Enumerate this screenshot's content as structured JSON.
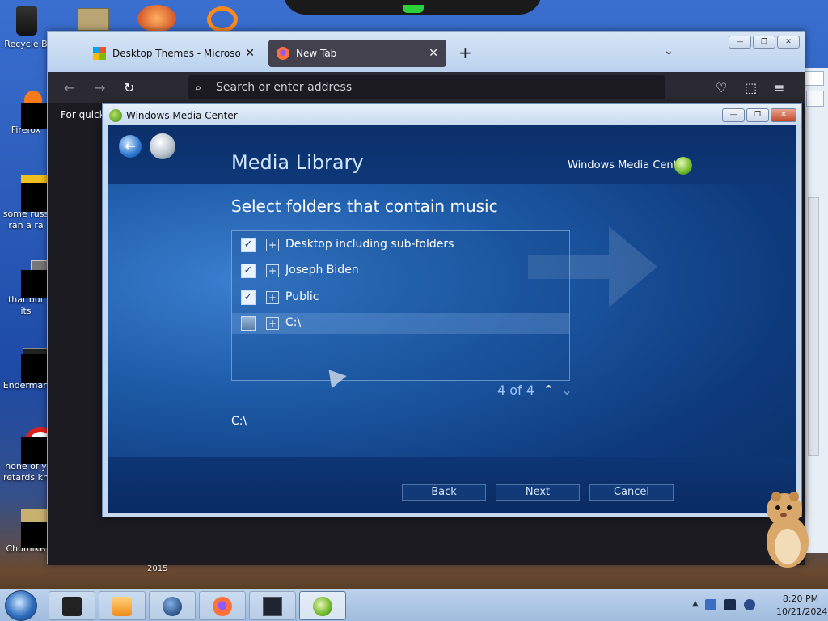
{
  "desktop": {
    "icons": [
      {
        "label": "Recycle B"
      },
      {
        "label": "Firefox"
      },
      {
        "label_line1": "some russ",
        "label_line2": "ran a ra"
      },
      {
        "label": "that but its"
      },
      {
        "label": "Enderman"
      },
      {
        "label_line1": "none of y",
        "label_line2": "retards kn"
      },
      {
        "label": "ChomikB"
      }
    ],
    "bg_year": "2015"
  },
  "browser": {
    "tabs": [
      {
        "title": "Desktop Themes - Microsoft Su",
        "close": "✕"
      },
      {
        "title": "New Tab",
        "close": "✕"
      }
    ],
    "new_tab": "+",
    "tab_list": "⌄",
    "window_buttons": {
      "min": "—",
      "max": "❐",
      "close": "✕"
    },
    "address_placeholder": "Search or enter address",
    "quick_text": "For quick",
    "nav": {
      "back": "←",
      "forward": "→",
      "reload": "↻",
      "pocket": "♡",
      "extensions": "⬚",
      "menu": "≡"
    }
  },
  "wmc": {
    "window_title": "Windows Media Center",
    "window_buttons": {
      "min": "—",
      "max": "❐",
      "close": "✕"
    },
    "back_glyph": "←",
    "page_title": "Media Library",
    "brand": "Windows Media Center",
    "heading": "Select folders that contain music",
    "folders": [
      {
        "label": "Desktop including sub-folders",
        "checked": true
      },
      {
        "label": "Joseph Biden",
        "checked": true
      },
      {
        "label": "Public",
        "checked": true
      },
      {
        "label": "C:\\",
        "checked": false
      }
    ],
    "check_glyph": "✓",
    "expand_glyph": "+",
    "pager": "4 of 4",
    "pager_up": "⌃",
    "pager_down": "⌄",
    "selected_path": "C:\\",
    "buttons": {
      "back": "Back",
      "next": "Next",
      "cancel": "Cancel"
    }
  },
  "taskbar": {
    "clock_time": "8:20 PM",
    "clock_date": "10/21/2024",
    "tray_chevron": "▲"
  },
  "colors": {
    "wmc_accent": "#0e3a7c",
    "title_text": "#cfe5ff",
    "pager_text": "#9dc7ff"
  }
}
